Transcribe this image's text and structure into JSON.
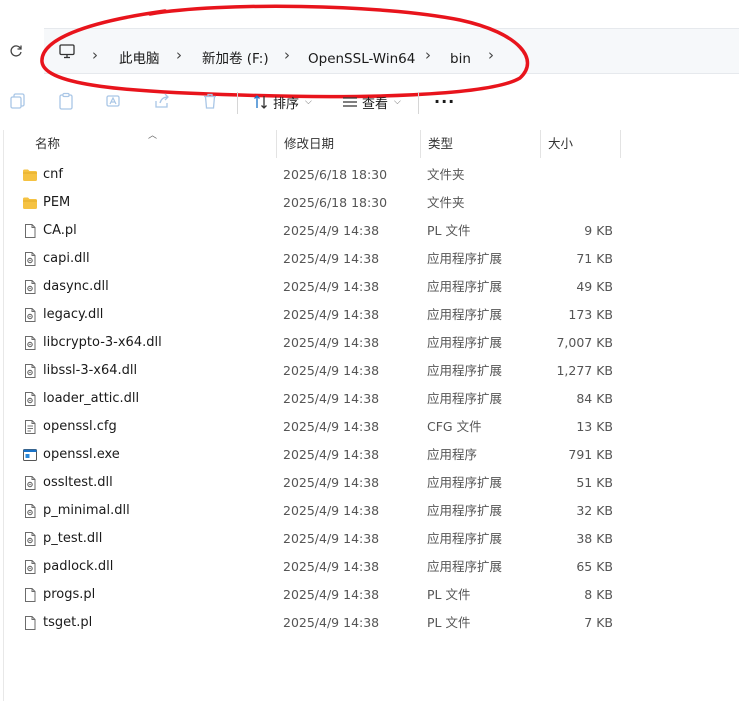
{
  "breadcrumb": {
    "items": [
      {
        "label": "此电脑"
      },
      {
        "label": "新加卷 (F:)"
      },
      {
        "label": "OpenSSL-Win64"
      },
      {
        "label": "bin"
      }
    ]
  },
  "toolbar": {
    "sort_label": "排序",
    "view_label": "查看",
    "more_label": "···"
  },
  "columns": {
    "name": "名称",
    "date": "修改日期",
    "type": "类型",
    "size": "大小"
  },
  "files": [
    {
      "name": "cnf",
      "date": "2025/6/18 18:30",
      "type": "文件夹",
      "size": "",
      "icon": "folder"
    },
    {
      "name": "PEM",
      "date": "2025/6/18 18:30",
      "type": "文件夹",
      "size": "",
      "icon": "folder"
    },
    {
      "name": "CA.pl",
      "date": "2025/4/9 14:38",
      "type": "PL 文件",
      "size": "9 KB",
      "icon": "file"
    },
    {
      "name": "capi.dll",
      "date": "2025/4/9 14:38",
      "type": "应用程序扩展",
      "size": "71 KB",
      "icon": "dll"
    },
    {
      "name": "dasync.dll",
      "date": "2025/4/9 14:38",
      "type": "应用程序扩展",
      "size": "49 KB",
      "icon": "dll"
    },
    {
      "name": "legacy.dll",
      "date": "2025/4/9 14:38",
      "type": "应用程序扩展",
      "size": "173 KB",
      "icon": "dll"
    },
    {
      "name": "libcrypto-3-x64.dll",
      "date": "2025/4/9 14:38",
      "type": "应用程序扩展",
      "size": "7,007 KB",
      "icon": "dll"
    },
    {
      "name": "libssl-3-x64.dll",
      "date": "2025/4/9 14:38",
      "type": "应用程序扩展",
      "size": "1,277 KB",
      "icon": "dll"
    },
    {
      "name": "loader_attic.dll",
      "date": "2025/4/9 14:38",
      "type": "应用程序扩展",
      "size": "84 KB",
      "icon": "dll"
    },
    {
      "name": "openssl.cfg",
      "date": "2025/4/9 14:38",
      "type": "CFG 文件",
      "size": "13 KB",
      "icon": "cfg"
    },
    {
      "name": "openssl.exe",
      "date": "2025/4/9 14:38",
      "type": "应用程序",
      "size": "791 KB",
      "icon": "exe"
    },
    {
      "name": "ossltest.dll",
      "date": "2025/4/9 14:38",
      "type": "应用程序扩展",
      "size": "51 KB",
      "icon": "dll"
    },
    {
      "name": "p_minimal.dll",
      "date": "2025/4/9 14:38",
      "type": "应用程序扩展",
      "size": "32 KB",
      "icon": "dll"
    },
    {
      "name": "p_test.dll",
      "date": "2025/4/9 14:38",
      "type": "应用程序扩展",
      "size": "38 KB",
      "icon": "dll"
    },
    {
      "name": "padlock.dll",
      "date": "2025/4/9 14:38",
      "type": "应用程序扩展",
      "size": "65 KB",
      "icon": "dll"
    },
    {
      "name": "progs.pl",
      "date": "2025/4/9 14:38",
      "type": "PL 文件",
      "size": "8 KB",
      "icon": "file"
    },
    {
      "name": "tsget.pl",
      "date": "2025/4/9 14:38",
      "type": "PL 文件",
      "size": "7 KB",
      "icon": "file"
    }
  ],
  "colors": {
    "annotation": "#e8141c",
    "folder": "#f5c242",
    "accent": "#1a73c8"
  }
}
